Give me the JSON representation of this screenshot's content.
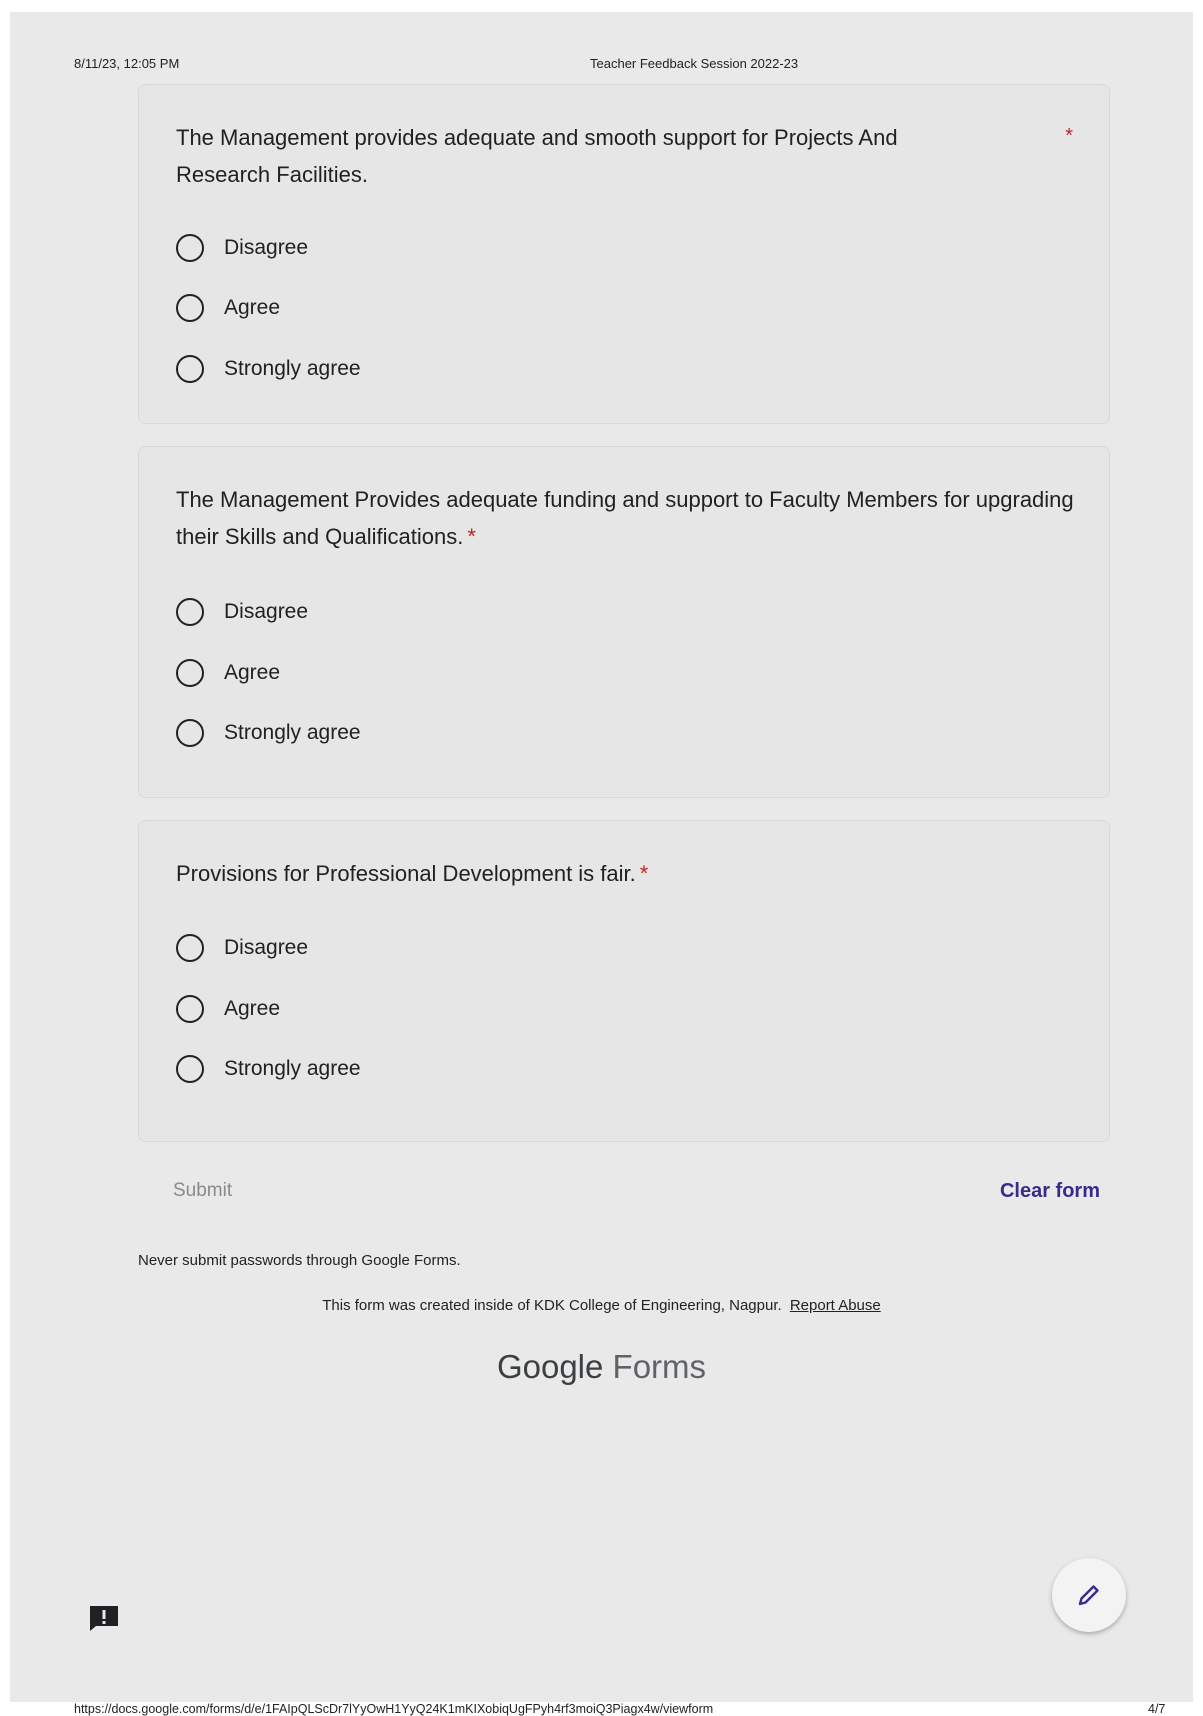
{
  "print_header": {
    "date": "8/11/23, 12:05 PM",
    "title": "Teacher Feedback Session 2022-23"
  },
  "questions": [
    {
      "text": "The Management provides adequate and smooth support for Projects And Research Facilities.",
      "required_mark": "*",
      "options": [
        "Disagree",
        "Agree",
        "Strongly agree"
      ]
    },
    {
      "text": "The Management Provides adequate funding and support to Faculty Members for upgrading their Skills and Qualifications.",
      "required_mark": "*",
      "options": [
        "Disagree",
        "Agree",
        "Strongly agree"
      ]
    },
    {
      "text": "Provisions for Professional Development is fair.",
      "required_mark": "*",
      "options": [
        "Disagree",
        "Agree",
        "Strongly agree"
      ]
    }
  ],
  "actions": {
    "submit_label": "Submit",
    "clear_label": "Clear form"
  },
  "footer": {
    "warning": "Never submit passwords through Google Forms.",
    "created_text": "This form was created inside of KDK College of Engineering, Nagpur.",
    "report_link": "Report Abuse",
    "logo_google": "Google",
    "logo_forms": "Forms"
  },
  "icons": {
    "feedback": "feedback-icon",
    "edit": "pencil-icon"
  },
  "print_footer": {
    "url": "https://docs.google.com/forms/d/e/1FAIpQLScDr7lYyOwH1YyQ24K1mKIXobiqUgFPyh4rf3moiQ3Piagx4w/viewform",
    "page": "4/7"
  }
}
